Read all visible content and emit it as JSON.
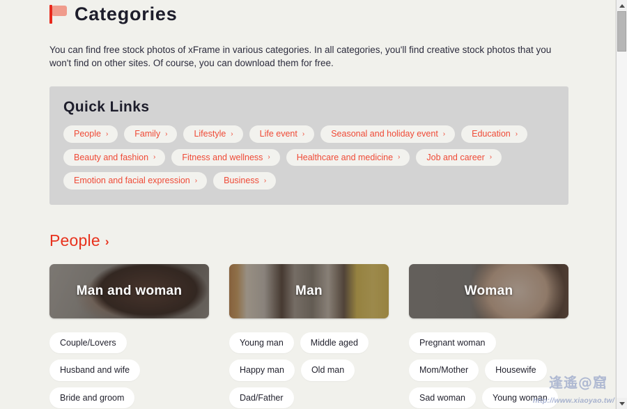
{
  "page": {
    "title": "Categories",
    "flag_icon": "flag-icon",
    "intro": "You can find free stock photos of xFrame in various categories. In all categories, you'll find creative stock photos that you won't find on other sites. Of course, you can download them for free."
  },
  "quick_links": {
    "heading": "Quick Links",
    "chevron": "›",
    "rows": [
      [
        {
          "label": "People"
        },
        {
          "label": "Family"
        },
        {
          "label": "Lifestyle"
        },
        {
          "label": "Life event"
        },
        {
          "label": "Seasonal and holiday event"
        },
        {
          "label": "Education"
        }
      ],
      [
        {
          "label": "Beauty and fashion"
        },
        {
          "label": "Fitness and wellness"
        },
        {
          "label": "Healthcare and medicine"
        },
        {
          "label": "Job and career"
        }
      ],
      [
        {
          "label": "Emotion and facial expression"
        },
        {
          "label": "Business"
        }
      ]
    ]
  },
  "people_section": {
    "heading": "People",
    "chevron": "›",
    "columns": [
      {
        "card_label": "Man and woman",
        "tags": [
          "Couple/Lovers",
          "Husband and wife",
          "Bride and groom"
        ]
      },
      {
        "card_label": "Man",
        "tags": [
          "Young man",
          "Middle aged",
          "Happy man",
          "Old man",
          "Dad/Father"
        ]
      },
      {
        "card_label": "Woman",
        "tags": [
          "Pregnant woman",
          "Mom/Mother",
          "Housewife",
          "Sad woman",
          "Young woman"
        ]
      }
    ]
  },
  "watermark": {
    "logo": "逢遙@窟",
    "url": "http://www.xiaoyao.tw/"
  },
  "scrollbar": {
    "up_arrow": "scroll-up-arrow",
    "down_arrow": "scroll-down-arrow"
  },
  "colors": {
    "page_background": "#f1f1ec",
    "accent_red": "#e8321d",
    "pill_red": "#ef4a36",
    "panel_gray": "#d3d3d3",
    "text_dark": "#1d1d2b",
    "tag_background": "#ffffff"
  }
}
